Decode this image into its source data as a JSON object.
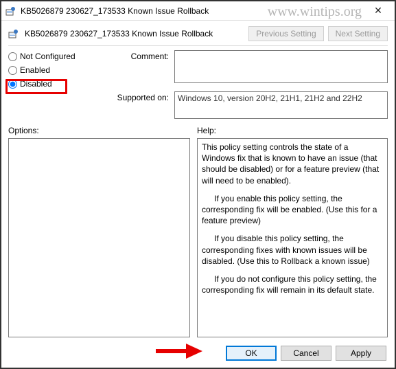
{
  "window": {
    "title": "KB5026879 230627_173533 Known Issue Rollback",
    "close_glyph": "✕"
  },
  "watermark": "www.wintips.org",
  "header": {
    "title": "KB5026879 230627_173533 Known Issue Rollback",
    "prev_label": "Previous Setting",
    "next_label": "Next Setting"
  },
  "radios": {
    "not_configured": "Not Configured",
    "enabled": "Enabled",
    "disabled": "Disabled",
    "selected": "disabled"
  },
  "comment": {
    "label": "Comment:",
    "value": ""
  },
  "supported": {
    "label": "Supported on:",
    "value": "Windows 10, version 20H2, 21H1, 21H2 and 22H2"
  },
  "options": {
    "label": "Options:"
  },
  "help": {
    "label": "Help:",
    "p1": "This policy setting controls the state of a Windows fix that is known to have an issue (that should be disabled) or for a feature preview (that will need to be enabled).",
    "p2": "If you enable this policy setting, the corresponding fix will be enabled. (Use this for a feature preview)",
    "p3": "If you disable this policy setting, the corresponding fixes with known issues will be disabled. (Use this to Rollback a known issue)",
    "p4": "If you do not configure this policy setting, the corresponding fix will remain in its default state."
  },
  "buttons": {
    "ok": "OK",
    "cancel": "Cancel",
    "apply": "Apply"
  }
}
